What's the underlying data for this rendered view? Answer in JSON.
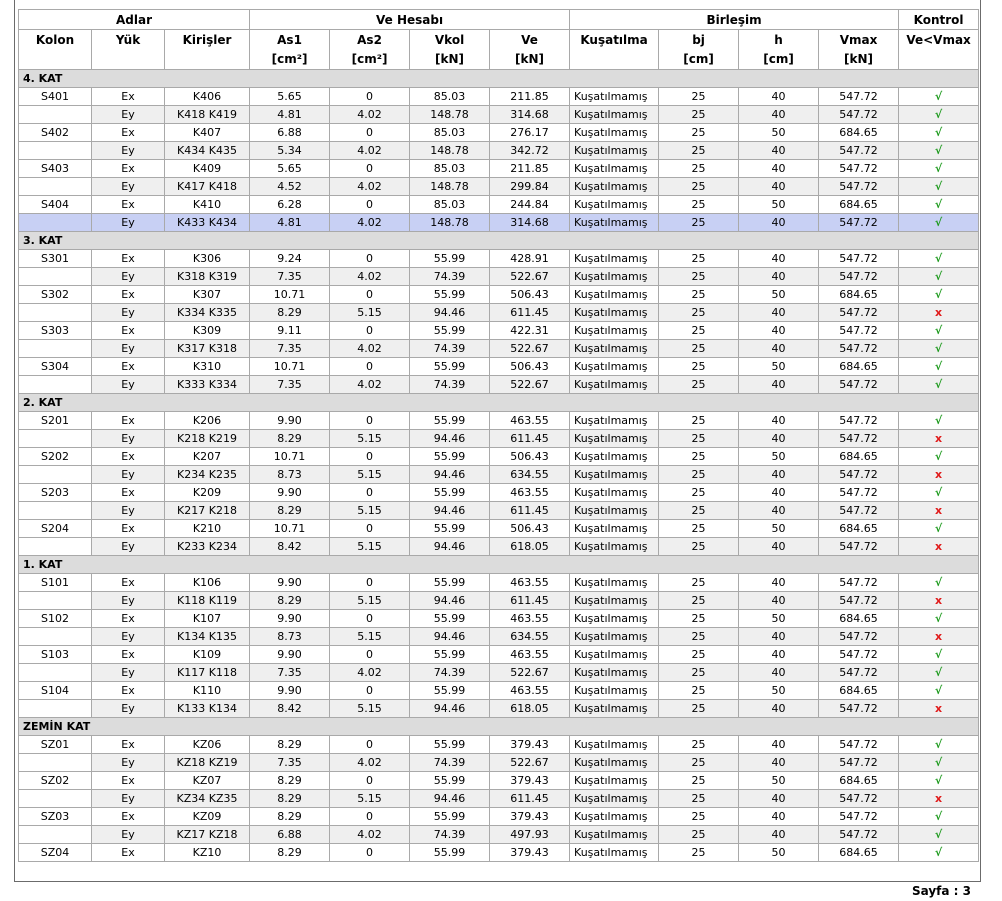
{
  "header": {
    "group1": "Adlar",
    "group2": "Ve Hesabı",
    "group3": "Birleşim",
    "group4": "Kontrol",
    "cols": [
      {
        "l1": "Kolon",
        "l2": ""
      },
      {
        "l1": "Yük",
        "l2": ""
      },
      {
        "l1": "Kirişler",
        "l2": ""
      },
      {
        "l1": "As1",
        "l2": "[cm²]"
      },
      {
        "l1": "As2",
        "l2": "[cm²]"
      },
      {
        "l1": "Vkol",
        "l2": "[kN]"
      },
      {
        "l1": "Ve",
        "l2": "[kN]"
      },
      {
        "l1": "Kuşatılma",
        "l2": ""
      },
      {
        "l1": "bj",
        "l2": "[cm]"
      },
      {
        "l1": "h",
        "l2": "[cm]"
      },
      {
        "l1": "Vmax",
        "l2": "[kN]"
      },
      {
        "l1": "Ve<Vmax",
        "l2": ""
      }
    ]
  },
  "status_labels": {
    "ok": "√",
    "fail": "x"
  },
  "sections": [
    {
      "title": "4. KAT",
      "rows": [
        [
          "S401",
          "Ex",
          "K406",
          "5.65",
          "0",
          "85.03",
          "211.85",
          "Kuşatılmamış",
          "25",
          "40",
          "547.72",
          "ok"
        ],
        [
          "",
          "Ey",
          "K418 K419",
          "4.81",
          "4.02",
          "148.78",
          "314.68",
          "Kuşatılmamış",
          "25",
          "40",
          "547.72",
          "ok"
        ],
        [
          "S402",
          "Ex",
          "K407",
          "6.88",
          "0",
          "85.03",
          "276.17",
          "Kuşatılmamış",
          "25",
          "50",
          "684.65",
          "ok"
        ],
        [
          "",
          "Ey",
          "K434 K435",
          "5.34",
          "4.02",
          "148.78",
          "342.72",
          "Kuşatılmamış",
          "25",
          "40",
          "547.72",
          "ok"
        ],
        [
          "S403",
          "Ex",
          "K409",
          "5.65",
          "0",
          "85.03",
          "211.85",
          "Kuşatılmamış",
          "25",
          "40",
          "547.72",
          "ok"
        ],
        [
          "",
          "Ey",
          "K417 K418",
          "4.52",
          "4.02",
          "148.78",
          "299.84",
          "Kuşatılmamış",
          "25",
          "40",
          "547.72",
          "ok"
        ],
        [
          "S404",
          "Ex",
          "K410",
          "6.28",
          "0",
          "85.03",
          "244.84",
          "Kuşatılmamış",
          "25",
          "50",
          "684.65",
          "ok"
        ],
        [
          "",
          "Ey",
          "K433 K434",
          "4.81",
          "4.02",
          "148.78",
          "314.68",
          "Kuşatılmamış",
          "25",
          "40",
          "547.72",
          "ok"
        ]
      ]
    },
    {
      "title": "3. KAT",
      "rows": [
        [
          "S301",
          "Ex",
          "K306",
          "9.24",
          "0",
          "55.99",
          "428.91",
          "Kuşatılmamış",
          "25",
          "40",
          "547.72",
          "ok"
        ],
        [
          "",
          "Ey",
          "K318 K319",
          "7.35",
          "4.02",
          "74.39",
          "522.67",
          "Kuşatılmamış",
          "25",
          "40",
          "547.72",
          "ok"
        ],
        [
          "S302",
          "Ex",
          "K307",
          "10.71",
          "0",
          "55.99",
          "506.43",
          "Kuşatılmamış",
          "25",
          "50",
          "684.65",
          "ok"
        ],
        [
          "",
          "Ey",
          "K334 K335",
          "8.29",
          "5.15",
          "94.46",
          "611.45",
          "Kuşatılmamış",
          "25",
          "40",
          "547.72",
          "fail"
        ],
        [
          "S303",
          "Ex",
          "K309",
          "9.11",
          "0",
          "55.99",
          "422.31",
          "Kuşatılmamış",
          "25",
          "40",
          "547.72",
          "ok"
        ],
        [
          "",
          "Ey",
          "K317 K318",
          "7.35",
          "4.02",
          "74.39",
          "522.67",
          "Kuşatılmamış",
          "25",
          "40",
          "547.72",
          "ok"
        ],
        [
          "S304",
          "Ex",
          "K310",
          "10.71",
          "0",
          "55.99",
          "506.43",
          "Kuşatılmamış",
          "25",
          "50",
          "684.65",
          "ok"
        ],
        [
          "",
          "Ey",
          "K333 K334",
          "7.35",
          "4.02",
          "74.39",
          "522.67",
          "Kuşatılmamış",
          "25",
          "40",
          "547.72",
          "ok"
        ]
      ]
    },
    {
      "title": "2. KAT",
      "rows": [
        [
          "S201",
          "Ex",
          "K206",
          "9.90",
          "0",
          "55.99",
          "463.55",
          "Kuşatılmamış",
          "25",
          "40",
          "547.72",
          "ok"
        ],
        [
          "",
          "Ey",
          "K218 K219",
          "8.29",
          "5.15",
          "94.46",
          "611.45",
          "Kuşatılmamış",
          "25",
          "40",
          "547.72",
          "fail"
        ],
        [
          "S202",
          "Ex",
          "K207",
          "10.71",
          "0",
          "55.99",
          "506.43",
          "Kuşatılmamış",
          "25",
          "50",
          "684.65",
          "ok"
        ],
        [
          "",
          "Ey",
          "K234 K235",
          "8.73",
          "5.15",
          "94.46",
          "634.55",
          "Kuşatılmamış",
          "25",
          "40",
          "547.72",
          "fail"
        ],
        [
          "S203",
          "Ex",
          "K209",
          "9.90",
          "0",
          "55.99",
          "463.55",
          "Kuşatılmamış",
          "25",
          "40",
          "547.72",
          "ok"
        ],
        [
          "",
          "Ey",
          "K217 K218",
          "8.29",
          "5.15",
          "94.46",
          "611.45",
          "Kuşatılmamış",
          "25",
          "40",
          "547.72",
          "fail"
        ],
        [
          "S204",
          "Ex",
          "K210",
          "10.71",
          "0",
          "55.99",
          "506.43",
          "Kuşatılmamış",
          "25",
          "50",
          "684.65",
          "ok"
        ],
        [
          "",
          "Ey",
          "K233 K234",
          "8.42",
          "5.15",
          "94.46",
          "618.05",
          "Kuşatılmamış",
          "25",
          "40",
          "547.72",
          "fail"
        ]
      ]
    },
    {
      "title": "1. KAT",
      "rows": [
        [
          "S101",
          "Ex",
          "K106",
          "9.90",
          "0",
          "55.99",
          "463.55",
          "Kuşatılmamış",
          "25",
          "40",
          "547.72",
          "ok"
        ],
        [
          "",
          "Ey",
          "K118 K119",
          "8.29",
          "5.15",
          "94.46",
          "611.45",
          "Kuşatılmamış",
          "25",
          "40",
          "547.72",
          "fail"
        ],
        [
          "S102",
          "Ex",
          "K107",
          "9.90",
          "0",
          "55.99",
          "463.55",
          "Kuşatılmamış",
          "25",
          "50",
          "684.65",
          "ok"
        ],
        [
          "",
          "Ey",
          "K134 K135",
          "8.73",
          "5.15",
          "94.46",
          "634.55",
          "Kuşatılmamış",
          "25",
          "40",
          "547.72",
          "fail"
        ],
        [
          "S103",
          "Ex",
          "K109",
          "9.90",
          "0",
          "55.99",
          "463.55",
          "Kuşatılmamış",
          "25",
          "40",
          "547.72",
          "ok"
        ],
        [
          "",
          "Ey",
          "K117 K118",
          "7.35",
          "4.02",
          "74.39",
          "522.67",
          "Kuşatılmamış",
          "25",
          "40",
          "547.72",
          "ok"
        ],
        [
          "S104",
          "Ex",
          "K110",
          "9.90",
          "0",
          "55.99",
          "463.55",
          "Kuşatılmamış",
          "25",
          "50",
          "684.65",
          "ok"
        ],
        [
          "",
          "Ey",
          "K133 K134",
          "8.42",
          "5.15",
          "94.46",
          "618.05",
          "Kuşatılmamış",
          "25",
          "40",
          "547.72",
          "fail"
        ]
      ]
    },
    {
      "title": "ZEMİN KAT",
      "rows": [
        [
          "SZ01",
          "Ex",
          "KZ06",
          "8.29",
          "0",
          "55.99",
          "379.43",
          "Kuşatılmamış",
          "25",
          "40",
          "547.72",
          "ok"
        ],
        [
          "",
          "Ey",
          "KZ18 KZ19",
          "7.35",
          "4.02",
          "74.39",
          "522.67",
          "Kuşatılmamış",
          "25",
          "40",
          "547.72",
          "ok"
        ],
        [
          "SZ02",
          "Ex",
          "KZ07",
          "8.29",
          "0",
          "55.99",
          "379.43",
          "Kuşatılmamış",
          "25",
          "50",
          "684.65",
          "ok"
        ],
        [
          "",
          "Ey",
          "KZ34 KZ35",
          "8.29",
          "5.15",
          "94.46",
          "611.45",
          "Kuşatılmamış",
          "25",
          "40",
          "547.72",
          "fail"
        ],
        [
          "SZ03",
          "Ex",
          "KZ09",
          "8.29",
          "0",
          "55.99",
          "379.43",
          "Kuşatılmamış",
          "25",
          "40",
          "547.72",
          "ok"
        ],
        [
          "",
          "Ey",
          "KZ17 KZ18",
          "6.88",
          "4.02",
          "74.39",
          "497.93",
          "Kuşatılmamış",
          "25",
          "40",
          "547.72",
          "ok"
        ],
        [
          "SZ04",
          "Ex",
          "KZ10",
          "8.29",
          "0",
          "55.99",
          "379.43",
          "Kuşatılmamış",
          "25",
          "50",
          "684.65",
          "ok"
        ]
      ]
    }
  ],
  "footer": {
    "page_label": "Sayfa : 3"
  }
}
